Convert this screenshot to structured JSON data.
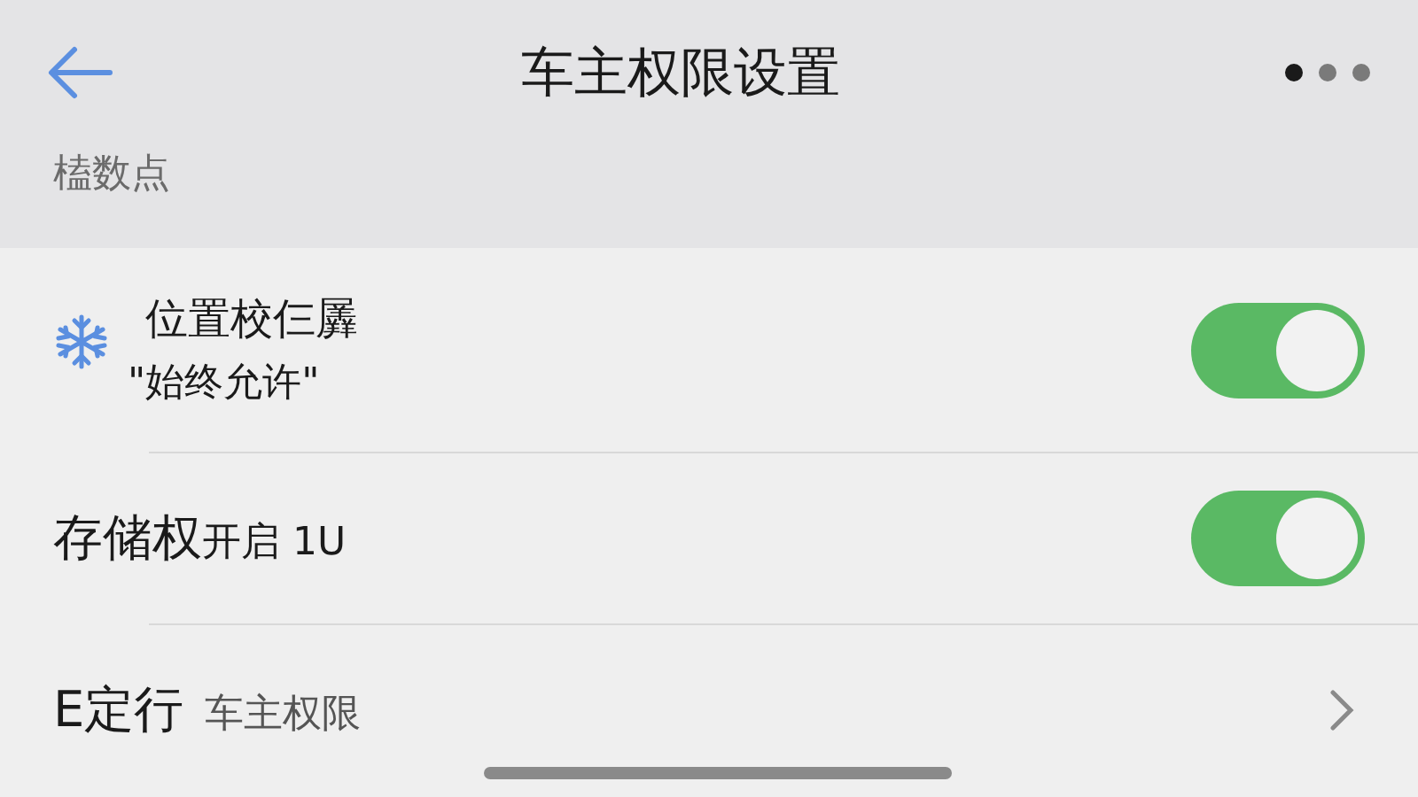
{
  "header": {
    "title": "车主权限设置"
  },
  "section": {
    "label": "榼数点"
  },
  "rows": [
    {
      "kind": "icon_toggle",
      "title": "位置校仨羼",
      "subtitle": "\"始终允许\"",
      "on": true
    },
    {
      "kind": "toggle",
      "title": "存储权",
      "detail": "开启 1U",
      "on": true
    },
    {
      "kind": "link",
      "title": "E定行",
      "detail": "车主权限"
    }
  ]
}
